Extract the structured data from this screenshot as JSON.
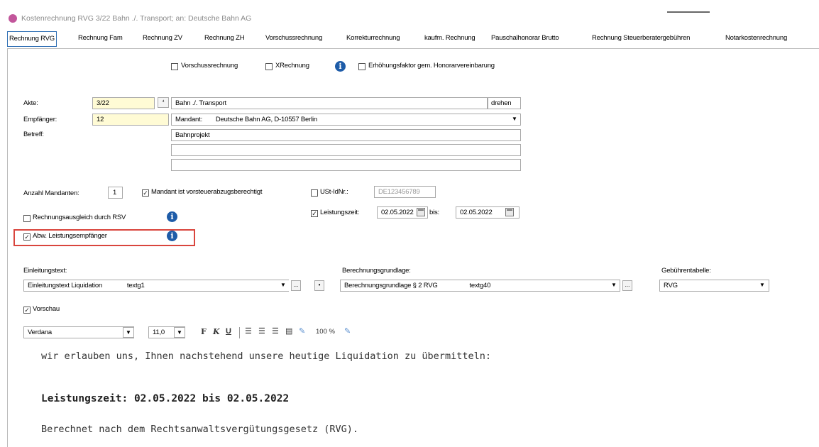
{
  "window": {
    "title": "Kostenrechnung RVG 3/22 Bahn ./. Transport; an: Deutsche Bahn AG"
  },
  "tabs": [
    {
      "label": "Rechnung RVG",
      "active": true
    },
    {
      "label": "Rechnung Fam"
    },
    {
      "label": "Rechnung ZV"
    },
    {
      "label": "Rechnung ZH"
    },
    {
      "label": "Vorschussrechnung"
    },
    {
      "label": "Korrekturrechnung"
    },
    {
      "label": "kaufm. Rechnung"
    },
    {
      "label": "Pauschalhonorar Brutto"
    },
    {
      "label": "Rechnung Steuerberatergebühren"
    },
    {
      "label": "Notarkostenrechnung"
    }
  ],
  "options_row": {
    "vorschuss": "Vorschussrechnung",
    "xrechnung": "XRechnung",
    "erhoehung": "Erhöhungsfaktor gem. Honorarvereinbarung"
  },
  "akte": {
    "label": "Akte:",
    "value": "3/22",
    "name": "Bahn ./. Transport",
    "drehen": "drehen"
  },
  "empfaenger": {
    "label": "Empfänger:",
    "value": "12",
    "role": "Mandant:",
    "address": "Deutsche Bahn AG, D-10557 Berlin"
  },
  "betreff": {
    "label": "Betreff:",
    "line1": "Bahnprojekt",
    "line2": "",
    "line3": ""
  },
  "mandanten": {
    "label": "Anzahl Mandanten:",
    "value": "1"
  },
  "vorsteuer": {
    "label": "Mandant ist vorsteuerabzugsberechtigt",
    "checked": true
  },
  "ustid": {
    "label": "USt-IdNr.:",
    "placeholder": "DE123456789",
    "checked": false
  },
  "rsv": {
    "label": "Rechnungsausgleich durch RSV",
    "checked": false
  },
  "leistungszeit": {
    "label": "Leistungszeit:",
    "from": "02.05.2022",
    "bis": "bis:",
    "to": "02.05.2022",
    "checked": true
  },
  "abw": {
    "label": "Abw. Leistungsempfänger",
    "checked": true
  },
  "einleitung": {
    "label": "Einleitungstext:",
    "value": "Einleitungstext Liquidation",
    "code": "textg1"
  },
  "berechnung": {
    "label": "Berechnungsgrundlage:",
    "value": "Berechnungsgrundlage § 2 RVG",
    "code": "textg40"
  },
  "gebuehren": {
    "label": "Gebührentabelle:",
    "value": "RVG"
  },
  "vorschau": {
    "label": "Vorschau",
    "checked": true
  },
  "editor": {
    "font": "Verdana",
    "size": "11,0",
    "bold": "F",
    "italic": "K",
    "underline": "U",
    "zoom": "100 %",
    "line1": "wir erlauben uns, Ihnen nachstehend unsere heutige Liquidation zu übermitteln:",
    "line2": "Leistungszeit: 02.05.2022 bis 02.05.2022",
    "line3": "Berechnet nach dem Rechtsanwaltsvergütungsgesetz (RVG)."
  },
  "colors": {
    "highlight": "#d9453d",
    "info": "#1e5ca8",
    "yellow_field": "#fffbd5",
    "tab_active_border": "#2f6fb4"
  }
}
